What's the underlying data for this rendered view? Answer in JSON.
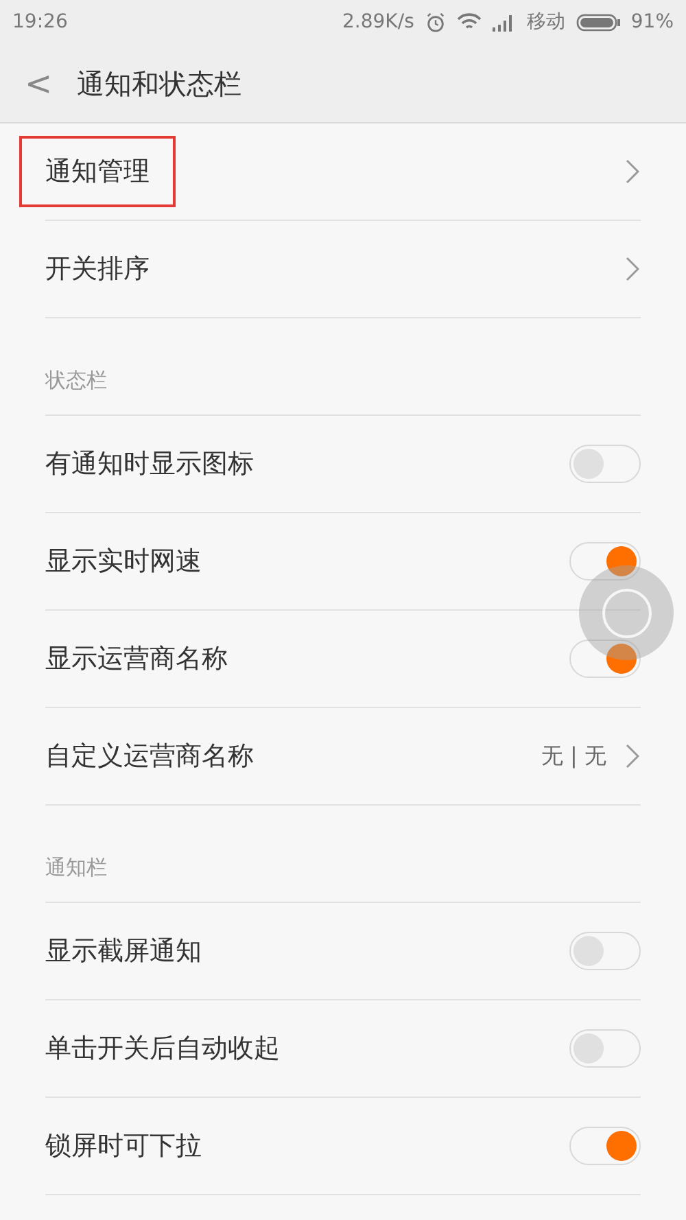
{
  "status_bar": {
    "time": "19:26",
    "speed": "2.89K/s",
    "carrier": "移动",
    "battery": "91%"
  },
  "header": {
    "back": "<",
    "title": "通知和状态栏"
  },
  "sections": [
    {
      "items": [
        {
          "kind": "link",
          "label": "通知管理",
          "highlighted": true
        },
        {
          "kind": "link",
          "label": "开关排序",
          "highlighted": false
        }
      ]
    },
    {
      "title": "状态栏",
      "items": [
        {
          "kind": "toggle",
          "label": "有通知时显示图标",
          "on": false
        },
        {
          "kind": "toggle",
          "label": "显示实时网速",
          "on": true
        },
        {
          "kind": "toggle",
          "label": "显示运营商名称",
          "on": true
        },
        {
          "kind": "link",
          "label": "自定义运营商名称",
          "value": "无 | 无",
          "highlighted": false
        }
      ]
    },
    {
      "title": "通知栏",
      "items": [
        {
          "kind": "toggle",
          "label": "显示截屏通知",
          "on": false
        },
        {
          "kind": "toggle",
          "label": "单击开关后自动收起",
          "on": false
        },
        {
          "kind": "toggle",
          "label": "锁屏时可下拉",
          "on": true
        }
      ]
    }
  ]
}
